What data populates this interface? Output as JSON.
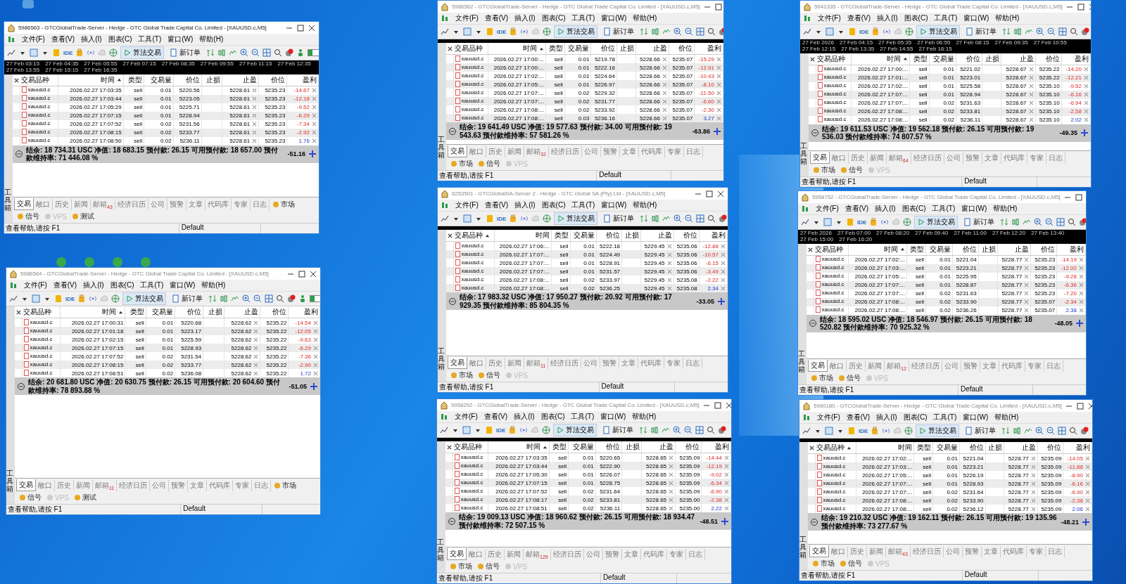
{
  "windows": [
    {
      "title": "5986563 - GTCGlobalTrade-Server - Hedge - GTC Global Trade Capital Co. Limited - [XAUUSD.c,M5]",
      "active": true,
      "menu": [
        "文件(F)",
        "查看(V)",
        "插入(I)",
        "图表(C)",
        "工具(T)",
        "窗口(W)",
        "帮助(H)"
      ],
      "toolbar": {
        "ide": "IDE",
        "algo": "算法交易",
        "new_order": "新订单"
      },
      "chart_strip": true,
      "timeline_labels": [
        "27 Feb 03:15",
        "27 Feb 04:35",
        "27 Feb 05:55",
        "27 Feb 07:15",
        "27 Feb 08:35",
        "27 Feb 09:55",
        "27 Feb 11:15",
        "27 Feb 12:35",
        "27 Feb 13:55",
        "27 Feb 15:15",
        "27 Feb 16:35"
      ],
      "columns": [
        {
          "label": "交易品种",
          "sorted": false
        },
        {
          "label": "时间",
          "sorted": true
        },
        {
          "label": "类型",
          "sorted": false
        },
        {
          "label": "交易量",
          "sorted": false
        },
        {
          "label": "价位",
          "sorted": false
        },
        {
          "label": "止损",
          "sorted": false
        },
        {
          "label": "止盈",
          "sorted": false
        },
        {
          "label": "价位",
          "sorted": false
        },
        {
          "label": "盈利",
          "sorted": false
        }
      ],
      "rows": [
        {
          "symbol": "xauusd.c",
          "time": "2026.02.27 17:03:35",
          "type": "sell",
          "volume": "0.01",
          "price": "5220.56",
          "tp": "5228.61",
          "price_now": "5235.23",
          "profit": "-14.67",
          "loss": true
        },
        {
          "symbol": "xauusd.c",
          "time": "2026.02.27 17:03:44",
          "type": "sell",
          "volume": "0.01",
          "price": "5223.05",
          "tp": "5228.61",
          "price_now": "5235.23",
          "profit": "-12.18",
          "loss": true
        },
        {
          "symbol": "xauusd.c",
          "time": "2026.02.27 17:05:29",
          "type": "sell",
          "volume": "0.01",
          "price": "5225.71",
          "tp": "5228.61",
          "price_now": "5235.23",
          "profit": "-9.52",
          "loss": true
        },
        {
          "symbol": "xauusd.c",
          "time": "2026.02.27 17:07:15",
          "type": "sell",
          "volume": "0.01",
          "price": "5228.94",
          "tp": "5228.61",
          "price_now": "5235.23",
          "profit": "-6.29",
          "loss": true
        },
        {
          "symbol": "xauusd.c",
          "time": "2026.02.27 17:07:52",
          "type": "sell",
          "volume": "0.02",
          "price": "5231.56",
          "tp": "5228.61",
          "price_now": "5235.23",
          "profit": "-7.34",
          "loss": true
        },
        {
          "symbol": "xauusd.c",
          "time": "2026.02.27 17:08:15",
          "type": "sell",
          "volume": "0.02",
          "price": "5233.77",
          "tp": "5228.61",
          "price_now": "5235.23",
          "profit": "-2.92",
          "loss": true
        },
        {
          "symbol": "xauusd.c",
          "time": "2026.02.27 17:08:50",
          "type": "sell",
          "volume": "0.02",
          "price": "5236.11",
          "tp": "5228.61",
          "price_now": "5235.23",
          "profit": "1.76",
          "loss": false
        }
      ],
      "summary": {
        "text": "结余: 18 734.31 USC 净值: 18 683.15 预付款: 26.15 可用预付款: 18 657.00 预付款维持率: 71 446.08 %",
        "total": "-51.16"
      },
      "side_label": "工具箱",
      "tabs": [
        {
          "label": "交易",
          "selected": true
        },
        {
          "label": "敞口",
          "selected": false
        },
        {
          "label": "历史",
          "selected": false
        },
        {
          "label": "新闻",
          "selected": false
        },
        {
          "label": "邮箱",
          "selected": false,
          "badge": "43"
        },
        {
          "label": "经济日历",
          "selected": false
        },
        {
          "label": "公司",
          "selected": false
        },
        {
          "label": "预警",
          "selected": false
        },
        {
          "label": "文章",
          "selected": false
        },
        {
          "label": "代码库",
          "selected": false
        },
        {
          "label": "专家",
          "selected": false
        },
        {
          "label": "日志",
          "selected": false
        }
      ],
      "panels": [
        {
          "label": "市场",
          "disabled": false
        },
        {
          "label": "信号",
          "disabled": false
        },
        {
          "label": "VPS",
          "disabled": true
        },
        {
          "label": "测试",
          "disabled": false
        }
      ],
      "status_bar": {
        "hint": "查看帮助,请按 F1",
        "profile": "Default"
      }
    },
    {
      "title": "5986562 - GTCGlobalTrade-Server - Hedge - GTC Global Trade Capital Co. Limited - [XAUUSD.c,M5]",
      "active": false,
      "menu": [
        "文件(F)",
        "查看(V)",
        "插入(I)",
        "图表(C)",
        "工具(T)",
        "窗口(W)",
        "帮助(H)"
      ],
      "toolbar": {
        "ide": "IDE",
        "algo": "算法交易",
        "new_order": "新订单"
      },
      "chart_strip": true,
      "columns": [
        {
          "label": "交易品种",
          "sorted": false
        },
        {
          "label": "时间",
          "sorted": true
        },
        {
          "label": "类型",
          "sorted": false
        },
        {
          "label": "交易量",
          "sorted": false
        },
        {
          "label": "价位",
          "sorted": false
        },
        {
          "label": "止损",
          "sorted": false
        },
        {
          "label": "止盈",
          "sorted": false
        },
        {
          "label": "价位",
          "sorted": false
        },
        {
          "label": "盈利",
          "sorted": false
        }
      ],
      "rows": [
        {
          "symbol": "xauusd.c",
          "time": "2026.02.27 17:00:...",
          "type": "sell",
          "volume": "0.01",
          "price": "5219.78",
          "tp": "5228.66",
          "price_now": "5235.07",
          "profit": "-15.29",
          "loss": true
        },
        {
          "symbol": "xauusd.c",
          "time": "2026.02.27 17:00:...",
          "type": "sell",
          "volume": "0.01",
          "price": "5222.16",
          "tp": "5228.66",
          "price_now": "5235.07",
          "profit": "-12.91",
          "loss": true
        },
        {
          "symbol": "xauusd.c",
          "time": "2026.02.27 17:02:...",
          "type": "sell",
          "volume": "0.01",
          "price": "5224.64",
          "tp": "5228.66",
          "price_now": "5235.07",
          "profit": "-10.43",
          "loss": true
        },
        {
          "symbol": "xauusd.c",
          "time": "2026.02.27 17:05:...",
          "type": "sell",
          "volume": "0.01",
          "price": "5226.97",
          "tp": "5228.66",
          "price_now": "5235.07",
          "profit": "-8.10",
          "loss": true
        },
        {
          "symbol": "xauusd.c",
          "time": "2026.02.27 17:07:...",
          "type": "sell",
          "volume": "0.02",
          "price": "5229.32",
          "tp": "5228.66",
          "price_now": "5235.07",
          "profit": "-11.50",
          "loss": true
        },
        {
          "symbol": "xauusd.c",
          "time": "2026.02.27 17:07:...",
          "type": "sell",
          "volume": "0.02",
          "price": "5231.77",
          "tp": "5228.66",
          "price_now": "5235.07",
          "profit": "-6.60",
          "loss": true
        },
        {
          "symbol": "xauusd.c",
          "time": "2026.02.27 17:08:...",
          "type": "sell",
          "volume": "0.02",
          "price": "5233.92",
          "tp": "5228.66",
          "price_now": "5235.07",
          "profit": "-2.30",
          "loss": true
        },
        {
          "symbol": "xauusd.c",
          "time": "2026.02.27 17:08:...",
          "type": "sell",
          "volume": "0.03",
          "price": "5236.16",
          "tp": "5228.66",
          "price_now": "5235.07",
          "profit": "3.27",
          "loss": false
        }
      ],
      "summary": {
        "text": "结余: 19 641.49 USC 净值: 19 577.63 预付款: 34.00 可用预付款: 19 543.63 预付款维持率: 57 581.26 %",
        "total": "-63.86"
      },
      "side_label": "工具箱",
      "tabs": [
        {
          "label": "交易",
          "selected": true
        },
        {
          "label": "敞口",
          "selected": false
        },
        {
          "label": "历史",
          "selected": false
        },
        {
          "label": "新闻",
          "selected": false
        },
        {
          "label": "邮箱",
          "selected": false,
          "badge": "32"
        },
        {
          "label": "经济日历",
          "selected": false
        },
        {
          "label": "公司",
          "selected": false
        },
        {
          "label": "预警",
          "selected": false
        },
        {
          "label": "文章",
          "selected": false
        },
        {
          "label": "代码库",
          "selected": false
        },
        {
          "label": "专家",
          "selected": false
        },
        {
          "label": "日志",
          "selected": false
        }
      ],
      "panels": [
        {
          "label": "市场",
          "disabled": false
        },
        {
          "label": "信号",
          "disabled": false
        },
        {
          "label": "VPS",
          "disabled": true
        }
      ],
      "status_bar": {
        "hint": "查看帮助,请按 F1",
        "profile": "Default"
      }
    },
    {
      "title": "5941335 - GTCGlobalTrade-Server - Hedge - GTC Global Trade Capital Co. Limited - [XAUUSD.c,M5]",
      "active": false,
      "menu": [
        "文件(F)",
        "查看(V)",
        "插入(I)",
        "图表(C)",
        "工具(T)",
        "窗口(W)",
        "帮助(H)"
      ],
      "toolbar": {
        "ide": "IDE",
        "algo": "算法交易",
        "new_order": "新订单"
      },
      "chart_strip": true,
      "timeline_labels": [
        "27 Feb 2026",
        "27 Feb 04:15",
        "27 Feb 05:35",
        "27 Feb 06:55",
        "27 Feb 08:15",
        "27 Feb 09:35",
        "27 Feb 10:55",
        "27 Feb 12:15",
        "27 Feb 13:35",
        "27 Feb 14:55",
        "27 Feb 16:15"
      ],
      "columns": [
        {
          "label": "交易品种",
          "sorted": false
        },
        {
          "label": "时间",
          "sorted": true
        },
        {
          "label": "类型",
          "sorted": false
        },
        {
          "label": "交易量",
          "sorted": false
        },
        {
          "label": "价位",
          "sorted": false
        },
        {
          "label": "止损",
          "sorted": false
        },
        {
          "label": "止盈",
          "sorted": false
        },
        {
          "label": "价位",
          "sorted": false
        },
        {
          "label": "盈利",
          "sorted": false
        }
      ],
      "rows": [
        {
          "symbol": "xauusd.c",
          "time": "2026.02.27 17:00:...",
          "type": "sell",
          "volume": "0.01",
          "price": "5221.02",
          "tp": "5228.67",
          "price_now": "5235.22",
          "profit": "-14.20",
          "loss": true
        },
        {
          "symbol": "xauusd.c",
          "time": "2026.02.27 17:01:...",
          "type": "sell",
          "volume": "0.01",
          "price": "5223.01",
          "tp": "5228.67",
          "price_now": "5235.22",
          "profit": "-12.21",
          "loss": true
        },
        {
          "symbol": "xauusd.c",
          "time": "2026.02.27 17:02:...",
          "type": "sell",
          "volume": "0.01",
          "price": "5225.58",
          "tp": "5228.67",
          "price_now": "5235.10",
          "profit": "-9.52",
          "loss": true
        },
        {
          "symbol": "xauusd.c",
          "time": "2026.02.27 17:07:...",
          "type": "sell",
          "volume": "0.01",
          "price": "5228.94",
          "tp": "5228.67",
          "price_now": "5235.10",
          "profit": "-6.16",
          "loss": true
        },
        {
          "symbol": "xauusd.c",
          "time": "2026.02.27 17:07:...",
          "type": "sell",
          "volume": "0.02",
          "price": "5231.63",
          "tp": "5228.67",
          "price_now": "5235.10",
          "profit": "-6.94",
          "loss": true
        },
        {
          "symbol": "xauusd.c",
          "time": "2026.02.27 17:08:...",
          "type": "sell",
          "volume": "0.02",
          "price": "5233.81",
          "tp": "5228.67",
          "price_now": "5235.10",
          "profit": "-2.58",
          "loss": true
        },
        {
          "symbol": "xauusd.c",
          "time": "2026.02.27 17:08:...",
          "type": "sell",
          "volume": "0.02",
          "price": "5236.11",
          "tp": "5228.67",
          "price_now": "5235.10",
          "profit": "2.02",
          "loss": false
        }
      ],
      "summary": {
        "text": "结余: 19 611.53 USC 净值: 19 562.18 预付款: 26.15 可用预付款: 19 536.03 预付款维持率: 74 807.57 %",
        "total": "-49.35"
      },
      "side_label": "工具箱",
      "tabs": [
        {
          "label": "交易",
          "selected": true
        },
        {
          "label": "敞口",
          "selected": false
        },
        {
          "label": "历史",
          "selected": false
        },
        {
          "label": "新闻",
          "selected": false
        },
        {
          "label": "邮箱",
          "selected": false,
          "badge": "64"
        },
        {
          "label": "经济日历",
          "selected": false
        },
        {
          "label": "公司",
          "selected": false
        },
        {
          "label": "预警",
          "selected": false
        },
        {
          "label": "文章",
          "selected": false
        },
        {
          "label": "代码库",
          "selected": false
        },
        {
          "label": "专家",
          "selected": false
        },
        {
          "label": "日志",
          "selected": false
        }
      ],
      "panels": [
        {
          "label": "市场",
          "disabled": false
        },
        {
          "label": "信号",
          "disabled": false
        },
        {
          "label": "VPS",
          "disabled": true
        }
      ],
      "status_bar": {
        "hint": "查看帮助,请按 F1",
        "profile": "Default"
      }
    },
    {
      "title": "6253501 - GTCGlobalSA-Server 2 - Hedge - GTC Global SA (Pty) Ltd - [XAUUSD.c,M5]",
      "active": false,
      "menu": [
        "文件(F)",
        "查看(V)",
        "插入(I)",
        "图表(C)",
        "工具(T)",
        "窗口(W)",
        "帮助(H)"
      ],
      "toolbar": {
        "ide": "IDE",
        "algo": "算法交易",
        "new_order": "新订单"
      },
      "chart_strip": true,
      "columns": [
        {
          "label": "交易品种",
          "sorted": true
        },
        {
          "label": "时间",
          "sorted": false
        },
        {
          "label": "类型",
          "sorted": false
        },
        {
          "label": "交易量",
          "sorted": false
        },
        {
          "label": "价位",
          "sorted": false
        },
        {
          "label": "止损",
          "sorted": false
        },
        {
          "label": "止盈",
          "sorted": false
        },
        {
          "label": "价位",
          "sorted": false
        },
        {
          "label": "盈利",
          "sorted": false
        }
      ],
      "rows": [
        {
          "symbol": "xauusd.c",
          "time": "2026.02.27 17:06:...",
          "type": "sell",
          "volume": "0.01",
          "price": "5222.18",
          "tp": "5229.45",
          "price_now": "5235.06",
          "profit": "-12.88",
          "loss": true
        },
        {
          "symbol": "xauusd.c",
          "time": "2026.02.27 17:07:...",
          "type": "sell",
          "volume": "0.01",
          "price": "5224.49",
          "tp": "5229.45",
          "price_now": "5235.06",
          "profit": "-10.57",
          "loss": true
        },
        {
          "symbol": "xauusd.c",
          "time": "2026.02.27 17:07:...",
          "type": "sell",
          "volume": "0.01",
          "price": "5228.91",
          "tp": "5229.45",
          "price_now": "5235.06",
          "profit": "-6.15",
          "loss": true
        },
        {
          "symbol": "xauusd.c",
          "time": "2026.02.27 17:07:...",
          "type": "sell",
          "volume": "0.01",
          "price": "5231.57",
          "tp": "5229.45",
          "price_now": "5235.06",
          "profit": "-3.49",
          "loss": true
        },
        {
          "symbol": "xauusd.c",
          "time": "2026.02.27 17:08:...",
          "type": "sell",
          "volume": "0.02",
          "price": "5233.97",
          "tp": "5229.45",
          "price_now": "5235.08",
          "profit": "-2.22",
          "loss": true
        },
        {
          "symbol": "xauusd.c",
          "time": "2026.02.27 17:08:...",
          "type": "sell",
          "volume": "0.02",
          "price": "5236.25",
          "tp": "5229.45",
          "price_now": "5235.08",
          "profit": "2.34",
          "loss": false
        }
      ],
      "summary": {
        "text": "结余: 17 983.32 USC 净值: 17 950.27 预付款: 20.92 可用预付款: 17 929.35 预付款维持率: 85 804.35 %",
        "total": "-33.05"
      },
      "side_label": "工具箱",
      "tabs": [
        {
          "label": "交易",
          "selected": true
        },
        {
          "label": "敞口",
          "selected": false
        },
        {
          "label": "历史",
          "selected": false
        },
        {
          "label": "新闻",
          "selected": false
        },
        {
          "label": "邮箱",
          "selected": false,
          "badge": "11"
        },
        {
          "label": "经济日历",
          "selected": false
        },
        {
          "label": "公司",
          "selected": false
        },
        {
          "label": "预警",
          "selected": false
        },
        {
          "label": "文章",
          "selected": false
        },
        {
          "label": "代码库",
          "selected": false
        },
        {
          "label": "专家",
          "selected": false
        },
        {
          "label": "日志",
          "selected": false
        }
      ],
      "panels": [
        {
          "label": "市场",
          "disabled": false
        },
        {
          "label": "信号",
          "disabled": false
        },
        {
          "label": "VPS",
          "disabled": true
        }
      ],
      "status_bar": {
        "hint": "查看帮助,请按 F1",
        "profile": "Default"
      }
    },
    {
      "title": "5958752 - GTCGlobalTrade-Server - Hedge - GTC Global Trade Capital Co. Limited - [XAUUSD.c,M5]",
      "active": false,
      "menu": [
        "文件(F)",
        "查看(V)",
        "插入(I)",
        "图表(C)",
        "工具(T)",
        "窗口(W)",
        "帮助(H)"
      ],
      "toolbar": {
        "ide": "IDE",
        "algo": "算法交易",
        "new_order": "新订单"
      },
      "chart_strip": true,
      "timeline_labels": [
        "27 Feb 2026",
        "27 Feb 07:00",
        "27 Feb 08:20",
        "27 Feb 09:40",
        "27 Feb 11:00",
        "27 Feb 12:20",
        "27 Feb 13:40",
        "27 Feb 15:00",
        "27 Feb 16:20"
      ],
      "columns": [
        {
          "label": "交易品种",
          "sorted": false
        },
        {
          "label": "时间",
          "sorted": true
        },
        {
          "label": "类型",
          "sorted": false
        },
        {
          "label": "交易量",
          "sorted": false
        },
        {
          "label": "价位",
          "sorted": false
        },
        {
          "label": "止损",
          "sorted": false
        },
        {
          "label": "止盈",
          "sorted": false
        },
        {
          "label": "价位",
          "sorted": false
        },
        {
          "label": "盈利",
          "sorted": false
        }
      ],
      "rows": [
        {
          "symbol": "xauusd.c",
          "time": "2026.02.27 17:02:...",
          "type": "sell",
          "volume": "0.01",
          "price": "5221.04",
          "tp": "5228.77",
          "price_now": "5235.23",
          "profit": "-14.19",
          "loss": true
        },
        {
          "symbol": "xauusd.c",
          "time": "2026.02.27 17:03:...",
          "type": "sell",
          "volume": "0.01",
          "price": "5223.21",
          "tp": "5228.77",
          "price_now": "5235.23",
          "profit": "-12.02",
          "loss": true
        },
        {
          "symbol": "xauusd.c",
          "time": "2026.02.27 17:05:...",
          "type": "sell",
          "volume": "0.01",
          "price": "5225.95",
          "tp": "5228.77",
          "price_now": "5235.23",
          "profit": "-9.28",
          "loss": true
        },
        {
          "symbol": "xauusd.c",
          "time": "2026.02.27 17:07:...",
          "type": "sell",
          "volume": "0.01",
          "price": "5228.87",
          "tp": "5228.77",
          "price_now": "5235.23",
          "profit": "-6.36",
          "loss": true
        },
        {
          "symbol": "xauusd.c",
          "time": "2026.02.27 17:07:...",
          "type": "sell",
          "volume": "0.02",
          "price": "5231.63",
          "tp": "5228.77",
          "price_now": "5235.23",
          "profit": "-7.20",
          "loss": true
        },
        {
          "symbol": "xauusd.c",
          "time": "2026.02.27 17:08:...",
          "type": "sell",
          "volume": "0.02",
          "price": "5233.90",
          "tp": "5228.77",
          "price_now": "5235.07",
          "profit": "-2.34",
          "loss": true
        },
        {
          "symbol": "xauusd.c",
          "time": "2026.02.27 17:08:...",
          "type": "sell",
          "volume": "0.02",
          "price": "5236.26",
          "tp": "5228.77",
          "price_now": "5235.07",
          "profit": "2.38",
          "loss": false
        }
      ],
      "summary": {
        "text": "结余: 18 595.02 USC 净值: 18 546.97 预付款: 26.15 可用预付款: 18 520.82 预付款维持率: 70 925.32 %",
        "total": "-48.05"
      },
      "side_label": "工具箱",
      "tabs": [
        {
          "label": "交易",
          "selected": true
        },
        {
          "label": "敞口",
          "selected": false
        },
        {
          "label": "历史",
          "selected": false
        },
        {
          "label": "新闻",
          "selected": false
        },
        {
          "label": "邮箱",
          "selected": false,
          "badge": "12"
        },
        {
          "label": "经济日历",
          "selected": false
        },
        {
          "label": "公司",
          "selected": false
        },
        {
          "label": "预警",
          "selected": false
        },
        {
          "label": "文章",
          "selected": false
        },
        {
          "label": "代码库",
          "selected": false
        },
        {
          "label": "专家",
          "selected": false
        },
        {
          "label": "日志",
          "selected": false
        }
      ],
      "panels": [
        {
          "label": "市场",
          "disabled": false
        },
        {
          "label": "信号",
          "disabled": false
        },
        {
          "label": "VPS",
          "disabled": true
        }
      ],
      "status_bar": {
        "hint": "查看帮助,请按 F1",
        "profile": "Default"
      }
    },
    {
      "title": "5986564 - GTCGlobalTrade-Server - Hedge - GTC Global Trade Capital Co. Limited - [XAUUSD.c,M5]",
      "active": false,
      "menu": [
        "文件(F)",
        "查看(V)",
        "插入(I)",
        "图表(C)",
        "工具(T)",
        "窗口(W)",
        "帮助(H)"
      ],
      "toolbar": {
        "ide": "IDE",
        "algo": "算法交易",
        "new_order": "新订单"
      },
      "chart_strip": false,
      "columns": [
        {
          "label": "交易品种",
          "sorted": false
        },
        {
          "label": "时间",
          "sorted": true
        },
        {
          "label": "类型",
          "sorted": false
        },
        {
          "label": "交易量",
          "sorted": false
        },
        {
          "label": "价位",
          "sorted": false
        },
        {
          "label": "止损",
          "sorted": false
        },
        {
          "label": "止盈",
          "sorted": false
        },
        {
          "label": "价位",
          "sorted": false
        },
        {
          "label": "盈利",
          "sorted": false
        }
      ],
      "rows": [
        {
          "symbol": "xauusd.c",
          "time": "2026.02.27 17:00:31",
          "type": "sell",
          "volume": "0.01",
          "price": "5220.68",
          "tp": "5228.62",
          "price_now": "5235.22",
          "profit": "-14.54",
          "loss": true
        },
        {
          "symbol": "xauusd.c",
          "time": "2026.02.27 17:01:18",
          "type": "sell",
          "volume": "0.01",
          "price": "5223.17",
          "tp": "5228.62",
          "price_now": "5235.22",
          "profit": "-12.05",
          "loss": true
        },
        {
          "symbol": "xauusd.c",
          "time": "2026.02.27 17:02:15",
          "type": "sell",
          "volume": "0.01",
          "price": "5225.59",
          "tp": "5228.62",
          "price_now": "5235.22",
          "profit": "-9.63",
          "loss": true
        },
        {
          "symbol": "xauusd.c",
          "time": "2026.02.27 17:07:15",
          "type": "sell",
          "volume": "0.01",
          "price": "5228.93",
          "tp": "5228.62",
          "price_now": "5235.22",
          "profit": "-6.29",
          "loss": true
        },
        {
          "symbol": "xauusd.c",
          "time": "2026.02.27 17:07:52",
          "type": "sell",
          "volume": "0.02",
          "price": "5231.54",
          "tp": "5228.62",
          "price_now": "5235.22",
          "profit": "-7.36",
          "loss": true
        },
        {
          "symbol": "xauusd.c",
          "time": "2026.02.27 17:08:15",
          "type": "sell",
          "volume": "0.02",
          "price": "5233.77",
          "tp": "5228.62",
          "price_now": "5235.22",
          "profit": "-2.90",
          "loss": true
        },
        {
          "symbol": "xauusd.c",
          "time": "2026.02.27 17:08:51",
          "type": "sell",
          "volume": "0.02",
          "price": "5236.08",
          "tp": "5228.62",
          "price_now": "5235.22",
          "profit": "1.72",
          "loss": false
        }
      ],
      "summary": {
        "text": "结余: 20 681.80 USC 净值: 20 630.75 预付款: 26.15 可用预付款: 20 604.60 预付款维持率: 78 893.88 %",
        "total": "-51.05"
      },
      "side_label": "工具箱",
      "tabs": [
        {
          "label": "交易",
          "selected": true
        },
        {
          "label": "敞口",
          "selected": false
        },
        {
          "label": "历史",
          "selected": false
        },
        {
          "label": "新闻",
          "selected": false
        },
        {
          "label": "邮箱",
          "selected": false,
          "badge": "11"
        },
        {
          "label": "经济日历",
          "selected": false
        },
        {
          "label": "公司",
          "selected": false
        },
        {
          "label": "预警",
          "selected": false
        },
        {
          "label": "文章",
          "selected": false
        },
        {
          "label": "代码库",
          "selected": false
        },
        {
          "label": "专家",
          "selected": false
        },
        {
          "label": "日志",
          "selected": false
        }
      ],
      "panels": [
        {
          "label": "市场",
          "disabled": false
        },
        {
          "label": "信号",
          "disabled": false
        },
        {
          "label": "VPS",
          "disabled": true
        },
        {
          "label": "测试",
          "disabled": false
        }
      ],
      "status_bar": {
        "hint": "查看帮助,请按 F1",
        "profile": "Default"
      }
    },
    {
      "title": "5958292 - GTCGlobalTrade-Server - Hedge - GTC Global Trade Capital Co. Limited - [XAUUSD.c,M5]",
      "active": false,
      "menu": [
        "文件(F)",
        "查看(V)",
        "插入(I)",
        "图表(C)",
        "工具(T)",
        "窗口(W)",
        "帮助(H)"
      ],
      "toolbar": {
        "ide": "IDE",
        "algo": "算法交易",
        "new_order": "新订单"
      },
      "chart_strip": true,
      "columns": [
        {
          "label": "交易品种",
          "sorted": false
        },
        {
          "label": "时间",
          "sorted": true
        },
        {
          "label": "类型",
          "sorted": false
        },
        {
          "label": "交易量",
          "sorted": false
        },
        {
          "label": "价位",
          "sorted": false
        },
        {
          "label": "止损",
          "sorted": false
        },
        {
          "label": "止盈",
          "sorted": false
        },
        {
          "label": "价位",
          "sorted": false
        },
        {
          "label": "盈利",
          "sorted": false
        }
      ],
      "rows": [
        {
          "symbol": "xauusd.c",
          "time": "2026.02.27 17:03:35",
          "type": "sell",
          "volume": "0.01",
          "price": "5220.65",
          "tp": "5228.65",
          "price_now": "5235.09",
          "profit": "-14.44",
          "loss": true
        },
        {
          "symbol": "xauusd.c",
          "time": "2026.02.27 17:03:44",
          "type": "sell",
          "volume": "0.01",
          "price": "5222.90",
          "tp": "5228.65",
          "price_now": "5235.09",
          "profit": "-12.19",
          "loss": true
        },
        {
          "symbol": "xauusd.c",
          "time": "2026.02.27 17:05:30",
          "type": "sell",
          "volume": "0.01",
          "price": "5226.07",
          "tp": "5228.65",
          "price_now": "5235.09",
          "profit": "-9.02",
          "loss": true
        },
        {
          "symbol": "xauusd.c",
          "time": "2026.02.27 17:07:15",
          "type": "sell",
          "volume": "0.01",
          "price": "5228.75",
          "tp": "5228.65",
          "price_now": "5235.09",
          "profit": "-6.34",
          "loss": true
        },
        {
          "symbol": "xauusd.c",
          "time": "2026.02.27 17:07:52",
          "type": "sell",
          "volume": "0.02",
          "price": "5231.64",
          "tp": "5228.65",
          "price_now": "5235.09",
          "profit": "-6.90",
          "loss": true
        },
        {
          "symbol": "xauusd.c",
          "time": "2026.02.27 17:08:17",
          "type": "sell",
          "volume": "0.02",
          "price": "5233.81",
          "tp": "5228.65",
          "price_now": "5235.00",
          "profit": "-2.38",
          "loss": true
        },
        {
          "symbol": "xauusd.c",
          "time": "2026.02.27 17:08:51",
          "type": "sell",
          "volume": "0.02",
          "price": "5236.11",
          "tp": "5228.65",
          "price_now": "5235.00",
          "profit": "2.22",
          "loss": false
        }
      ],
      "summary": {
        "text": "结余: 19 009.13 USC 净值: 18 960.62 预付款: 26.15 可用预付款: 18 934.47 预付款维持率: 72 507.15 %",
        "total": "-48.51"
      },
      "side_label": "工具箱",
      "tabs": [
        {
          "label": "交易",
          "selected": true
        },
        {
          "label": "敞口",
          "selected": false
        },
        {
          "label": "历史",
          "selected": false
        },
        {
          "label": "新闻",
          "selected": false
        },
        {
          "label": "邮箱",
          "selected": false,
          "badge": "129"
        },
        {
          "label": "经济日历",
          "selected": false
        },
        {
          "label": "公司",
          "selected": false
        },
        {
          "label": "预警",
          "selected": false
        },
        {
          "label": "文章",
          "selected": false
        },
        {
          "label": "代码库",
          "selected": false
        },
        {
          "label": "专家",
          "selected": false
        },
        {
          "label": "日志",
          "selected": false
        }
      ],
      "panels": [
        {
          "label": "市场",
          "disabled": false
        },
        {
          "label": "信号",
          "disabled": false
        },
        {
          "label": "VPS",
          "disabled": true
        }
      ],
      "status_bar": {
        "hint": "查看帮助,请按 F1",
        "profile": "Default"
      }
    },
    {
      "title": "5960180 - GTCGlobalTrade-Server - Hedge - GTC Global Trade Capital Co. Limited - [XAUUSD.c,M5]",
      "active": false,
      "menu": [
        "文件(F)",
        "查看(V)",
        "插入(I)",
        "图表(C)",
        "工具(T)",
        "窗口(W)",
        "帮助(H)"
      ],
      "toolbar": {
        "ide": "IDE",
        "algo": "算法交易",
        "new_order": "新订单"
      },
      "chart_strip": true,
      "columns": [
        {
          "label": "交易品种",
          "sorted": true
        },
        {
          "label": "时间",
          "sorted": false
        },
        {
          "label": "类型",
          "sorted": false
        },
        {
          "label": "交易量",
          "sorted": false
        },
        {
          "label": "价位",
          "sorted": false
        },
        {
          "label": "止损",
          "sorted": false
        },
        {
          "label": "止盈",
          "sorted": false
        },
        {
          "label": "价位",
          "sorted": false
        },
        {
          "label": "盈利",
          "sorted": false
        }
      ],
      "rows": [
        {
          "symbol": "xauusd.c",
          "time": "2026.02.27 17:02:...",
          "type": "sell",
          "volume": "0.01",
          "price": "5221.04",
          "tp": "5228.77",
          "price_now": "5235.09",
          "profit": "-14.05",
          "loss": true
        },
        {
          "symbol": "xauusd.c",
          "time": "2026.02.27 17:03:...",
          "type": "sell",
          "volume": "0.01",
          "price": "5223.21",
          "tp": "5228.77",
          "price_now": "5235.09",
          "profit": "-11.88",
          "loss": true
        },
        {
          "symbol": "xauusd.c",
          "time": "2026.02.27 17:05:...",
          "type": "sell",
          "volume": "0.01",
          "price": "5226.19",
          "tp": "5228.77",
          "price_now": "5235.09",
          "profit": "-8.90",
          "loss": true
        },
        {
          "symbol": "xauusd.c",
          "time": "2026.02.27 17:07:...",
          "type": "sell",
          "volume": "0.01",
          "price": "5228.93",
          "tp": "5228.77",
          "price_now": "5235.09",
          "profit": "-6.16",
          "loss": true
        },
        {
          "symbol": "xauusd.c",
          "time": "2026.02.27 17:07:...",
          "type": "sell",
          "volume": "0.02",
          "price": "5231.64",
          "tp": "5228.77",
          "price_now": "5235.09",
          "profit": "-6.90",
          "loss": true
        },
        {
          "symbol": "xauusd.c",
          "time": "2026.02.27 17:08:...",
          "type": "sell",
          "volume": "0.02",
          "price": "5233.90",
          "tp": "5228.77",
          "price_now": "5235.09",
          "profit": "-2.38",
          "loss": true
        },
        {
          "symbol": "xauusd.c",
          "time": "2026.02.27 17:08:...",
          "type": "sell",
          "volume": "0.02",
          "price": "5236.12",
          "tp": "5228.77",
          "price_now": "5235.09",
          "profit": "2.06",
          "loss": false
        }
      ],
      "summary": {
        "text": "结余: 19 210.32 USC 净值: 19 162.11 预付款: 26.15 可用预付款: 19 135.96 预付款维持率: 73 277.67 %",
        "total": "-48.21"
      },
      "side_label": "工具箱",
      "tabs": [
        {
          "label": "交易",
          "selected": true
        },
        {
          "label": "敞口",
          "selected": false
        },
        {
          "label": "历史",
          "selected": false
        },
        {
          "label": "新闻",
          "selected": false
        },
        {
          "label": "邮箱",
          "selected": false,
          "badge": "43"
        },
        {
          "label": "经济日历",
          "selected": false
        },
        {
          "label": "公司",
          "selected": false
        },
        {
          "label": "预警",
          "selected": false
        },
        {
          "label": "文章",
          "selected": false
        },
        {
          "label": "代码库",
          "selected": false
        },
        {
          "label": "专家",
          "selected": false
        },
        {
          "label": "日志",
          "selected": false
        }
      ],
      "panels": [
        {
          "label": "市场",
          "disabled": false
        },
        {
          "label": "信号",
          "disabled": false
        },
        {
          "label": "VPS",
          "disabled": true
        }
      ],
      "status_bar": {
        "hint": "查看帮助,请按 F1",
        "profile": "Default"
      }
    }
  ]
}
